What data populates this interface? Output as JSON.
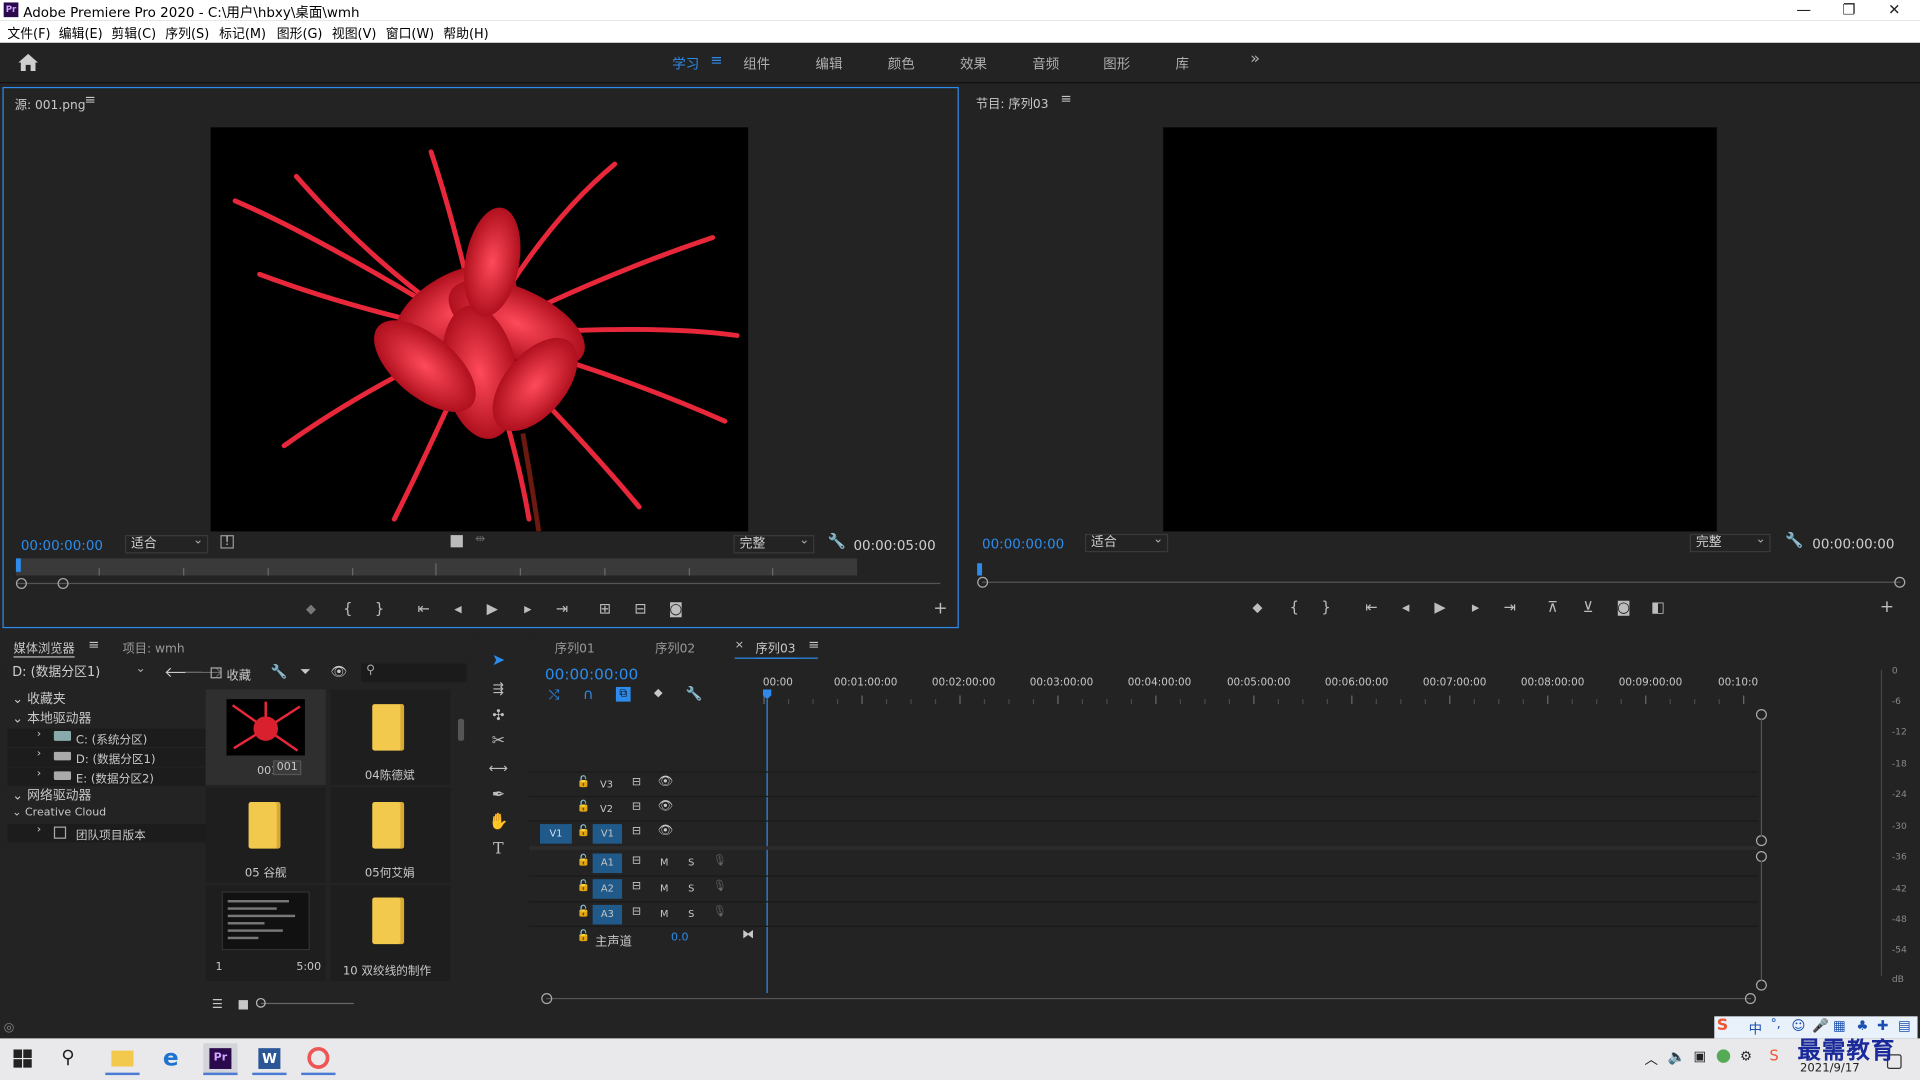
{
  "window": {
    "title": "Adobe Premiere Pro 2020 - C:\\用户\\hbxy\\桌面\\wmh",
    "logo": "Pr",
    "minimize": "—",
    "restore": "❐",
    "close": "✕"
  },
  "menu": [
    "文件(F)",
    "编辑(E)",
    "剪辑(C)",
    "序列(S)",
    "标记(M)",
    "图形(G)",
    "视图(V)",
    "窗口(W)",
    "帮助(H)"
  ],
  "workspaces": {
    "items": [
      "学习",
      "组件",
      "编辑",
      "颜色",
      "效果",
      "音频",
      "图形",
      "库"
    ],
    "active": "学习",
    "more": "»"
  },
  "source": {
    "title": "源: 001.png",
    "timecode": "00:00:00:00",
    "fit": "适合",
    "quality": "完整",
    "duration": "00:00:05:00",
    "playhead_fraction": 0.0
  },
  "program": {
    "title": "节目: 序列03",
    "timecode": "00:00:00:00",
    "fit": "适合",
    "quality": "完整",
    "duration": "00:00:00:00"
  },
  "project": {
    "tabs": [
      "媒体浏览器",
      "项目: wmh"
    ],
    "drive": "D: (数据分区1)",
    "favorites_label": "收藏",
    "tree": [
      "收藏夹",
      "本地驱动器",
      "C: (系统分区)",
      "D: (数据分区1)",
      "E: (数据分区2)",
      "网络驱动器",
      "Creative Cloud",
      "团队项目版本"
    ],
    "files": [
      {
        "name": "001",
        "tooltip": "001",
        "type": "image"
      },
      {
        "name": "04陈德斌",
        "type": "folder"
      },
      {
        "name": "05 谷舰",
        "type": "folder"
      },
      {
        "name": "05何艾娟",
        "type": "folder"
      },
      {
        "name": "1",
        "duration": "5:00",
        "type": "video"
      },
      {
        "name": "10 双绞线的制作",
        "type": "folder"
      }
    ]
  },
  "timeline": {
    "tabs": [
      "序列01",
      "序列02",
      "序列03"
    ],
    "active_tab": "序列03",
    "timecode": "00:00:00:00",
    "ruler": [
      "00:00",
      "00:01:00:00",
      "00:02:00:00",
      "00:03:00:00",
      "00:04:00:00",
      "00:05:00:00",
      "00:06:00:00",
      "00:07:00:00",
      "00:08:00:00",
      "00:09:00:00",
      "00:10:0"
    ],
    "video_tracks": [
      "V3",
      "V2",
      "V1"
    ],
    "source_patch": "V1",
    "audio_tracks": [
      "A1",
      "A2",
      "A3"
    ],
    "mute": "M",
    "solo": "S",
    "master_label": "主声道",
    "master_value": "0.0"
  },
  "meter": {
    "labels": [
      "0",
      "-6",
      "-12",
      "-18",
      "-24",
      "-30",
      "-36",
      "-42",
      "-48",
      "-54",
      "dB"
    ]
  },
  "taskbar": {
    "date": "2021/9/17",
    "ime": "中",
    "watermark": "最需教育"
  }
}
